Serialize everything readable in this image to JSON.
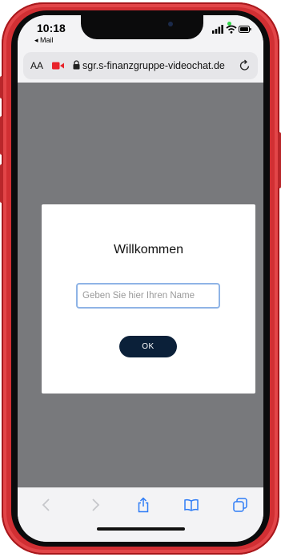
{
  "status_bar": {
    "time": "10:18",
    "back_app": "◂ Mail"
  },
  "url_bar": {
    "text_size_label": "AA",
    "url": "sgr.s-finanzgruppe-videochat.de"
  },
  "dialog": {
    "title": "Willkommen",
    "name_placeholder": "Geben Sie hier Ihren Name",
    "name_value": "",
    "ok_label": "OK"
  },
  "colors": {
    "frame": "#d12f33",
    "web_background": "#78797c",
    "button": "#0b2039",
    "input_border": "#8fb4e6",
    "camera_indicator": "#e8232a"
  },
  "icons": [
    "camera-icon",
    "lock-icon",
    "reload-icon",
    "back-icon",
    "forward-icon",
    "share-icon",
    "bookmarks-icon",
    "tabs-icon"
  ]
}
